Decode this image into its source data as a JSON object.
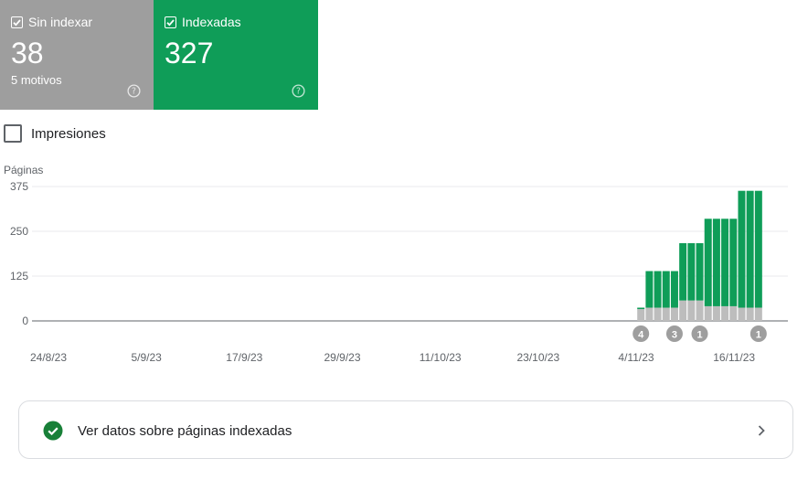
{
  "cards": {
    "not_indexed": {
      "label": "Sin indexar",
      "count": "38",
      "subtitle": "5 motivos",
      "color": "#9e9e9e"
    },
    "indexed": {
      "label": "Indexadas",
      "count": "327",
      "color": "#0f9d58"
    }
  },
  "impressions_label": "Impresiones",
  "chart_data": {
    "type": "bar",
    "stacked": true,
    "ylabel": "Páginas",
    "ylim": [
      0,
      375
    ],
    "yticks": [
      "375",
      "250",
      "125",
      "0"
    ],
    "xticks": [
      "24/8/23",
      "5/9/23",
      "17/9/23",
      "29/9/23",
      "11/10/23",
      "23/10/23",
      "4/11/23",
      "16/11/23"
    ],
    "x_start_label": "4/11/23",
    "x_start_index": 72,
    "x_total_days": 90,
    "series": [
      {
        "color": "#bdbdbd",
        "values": [
          33,
          37,
          37,
          37,
          37,
          57,
          57,
          57,
          41,
          41,
          41,
          41,
          37,
          37,
          37
        ]
      },
      {
        "color": "#0f9d58",
        "values": [
          4,
          102,
          102,
          102,
          102,
          160,
          160,
          160,
          244,
          244,
          244,
          244,
          326,
          326,
          326
        ]
      }
    ],
    "annotations": [
      {
        "label": "4",
        "day_index": 72
      },
      {
        "label": "3",
        "day_index": 76
      },
      {
        "label": "1",
        "day_index": 79
      },
      {
        "label": "1",
        "day_index": 86
      }
    ]
  },
  "footer": {
    "label": "Ver datos sobre páginas indexadas"
  }
}
